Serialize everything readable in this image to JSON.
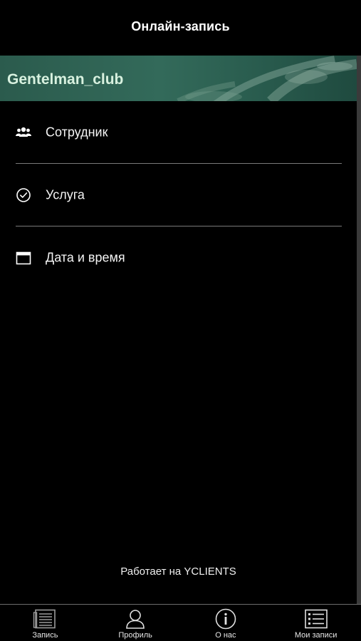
{
  "header": {
    "title": "Онлайн-запись"
  },
  "banner": {
    "title": "Gentelman_club"
  },
  "menu": {
    "items": [
      {
        "label": "Сотрудник",
        "icon": "people-icon"
      },
      {
        "label": "Услуга",
        "icon": "check-circle-icon"
      },
      {
        "label": "Дата и время",
        "icon": "calendar-icon"
      }
    ]
  },
  "footer": {
    "powered_by": "Работает на YCLIENTS"
  },
  "tabbar": {
    "items": [
      {
        "label": "Запись",
        "icon": "document-icon"
      },
      {
        "label": "Профиль",
        "icon": "user-icon"
      },
      {
        "label": "О нас",
        "icon": "info-icon"
      },
      {
        "label": "Мои записи",
        "icon": "list-icon"
      }
    ]
  },
  "colors": {
    "background": "#000000",
    "banner": "#2f6656",
    "banner_text": "#d8f1df",
    "divider": "#7a7a7a"
  }
}
